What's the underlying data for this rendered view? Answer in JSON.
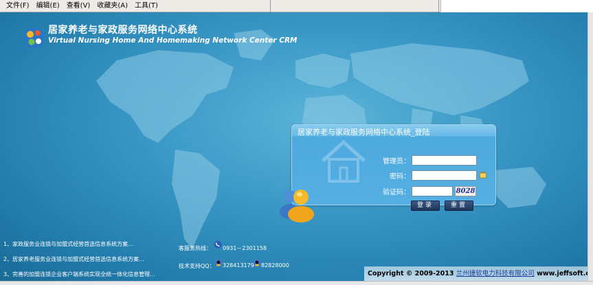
{
  "menu": {
    "items": [
      "文件(F)",
      "编辑(E)",
      "查看(V)",
      "收藏夹(A)",
      "工具(T)"
    ]
  },
  "header": {
    "title_cn": "居家养老与家政服务网络中心系统",
    "title_en": "Virtual Nursing Home And Homemaking Network Center CRM"
  },
  "login": {
    "title": "居家养老与家政服务网络中心系统_登陆",
    "admin_label": "管理员：",
    "password_label": "密码：",
    "captcha_label": "验证码：",
    "admin_value": "",
    "password_value": "",
    "captcha_value": "",
    "captcha_code": "8028",
    "login_button": "登录",
    "reset_button": "重置"
  },
  "news": [
    "1、家政服务业连锁与加盟式经营首选信息系统方案...",
    "2、居家养老服务业连锁与加盟式经营首选信息系统方案...",
    "3、完善的加盟连锁企业客户端系统实现全统一体化信息管理..."
  ],
  "contact": {
    "hotline_label": "客服务热线：",
    "hotline_value": "0931－2301158",
    "qq_label": "技术支持QQ：",
    "qq1": "328413179",
    "qq2": "82828000"
  },
  "footer": {
    "copyright_prefix": "Copyright © 2009-2013",
    "company": "兰州捷软电力科技有限公司",
    "website": "www.jeffsoft.cn"
  },
  "colors": {
    "background": "#3a97c5",
    "panel": "#55afe2",
    "button": "#1d3559"
  }
}
